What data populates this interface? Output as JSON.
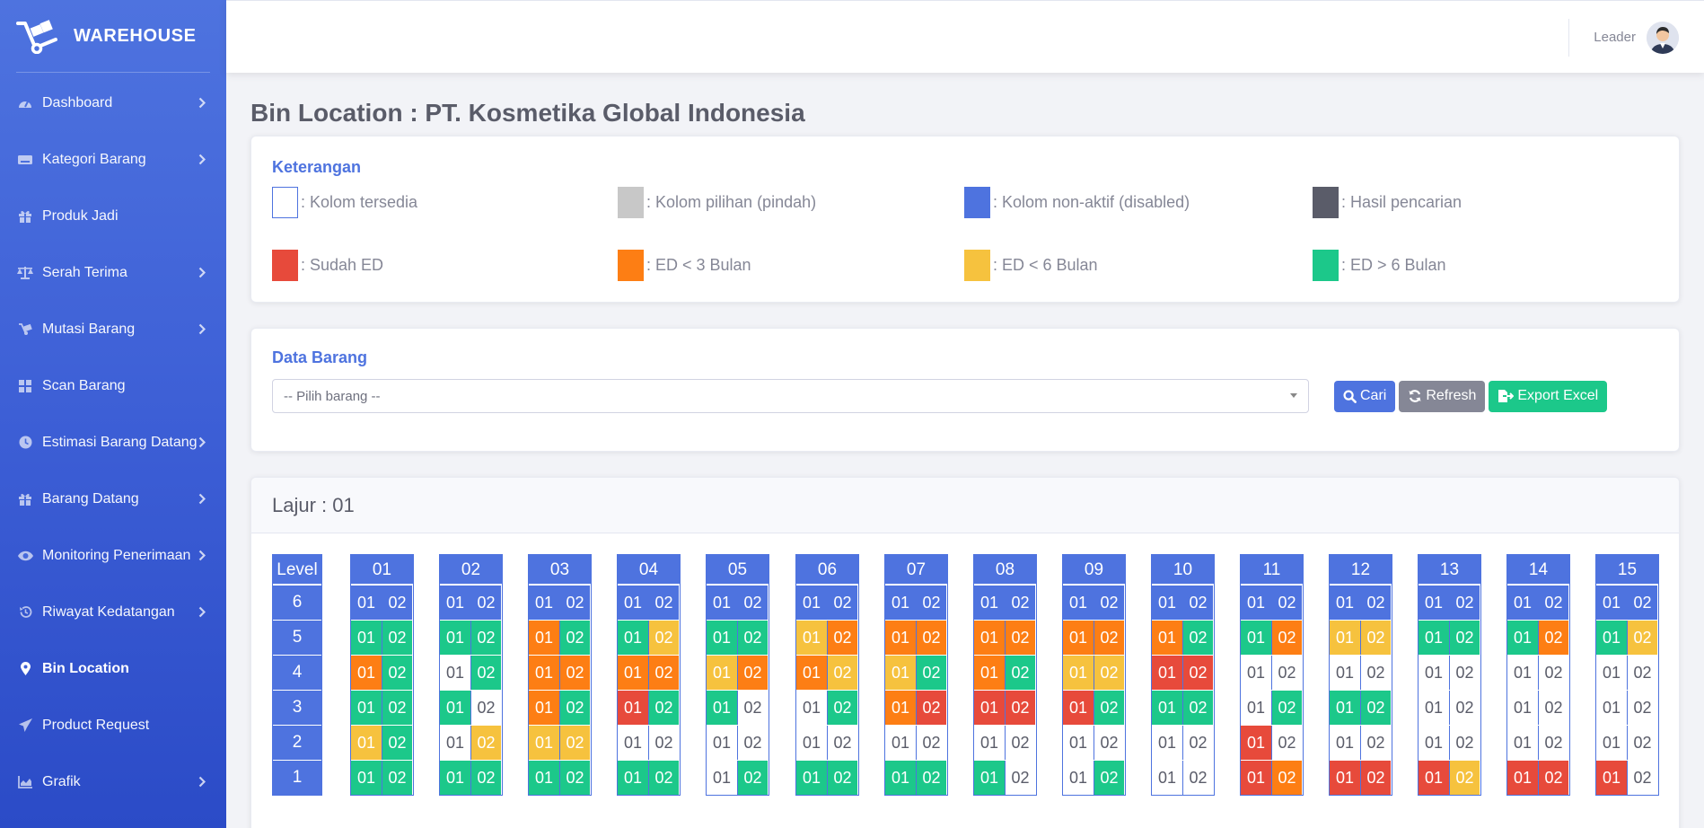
{
  "brand": {
    "name": "WAREHOUSE",
    "icon": "hand-truck-icon"
  },
  "sidebar": {
    "items": [
      {
        "label": "Dashboard",
        "icon": "tachometer-icon",
        "chevron": true,
        "active": false
      },
      {
        "label": "Kategori Barang",
        "icon": "keyboard-icon",
        "chevron": true,
        "active": false
      },
      {
        "label": "Produk Jadi",
        "icon": "gift-icon",
        "chevron": false,
        "active": false
      },
      {
        "label": "Serah Terima",
        "icon": "balance-scale-icon",
        "chevron": true,
        "active": false
      },
      {
        "label": "Mutasi Barang",
        "icon": "dolly-icon",
        "chevron": true,
        "active": false
      },
      {
        "label": "Scan Barang",
        "icon": "th-large-icon",
        "chevron": false,
        "active": false
      },
      {
        "label": "Estimasi Barang Datang",
        "icon": "clock-icon",
        "chevron": true,
        "active": false
      },
      {
        "label": "Barang Datang",
        "icon": "gift-icon",
        "chevron": true,
        "active": false
      },
      {
        "label": "Monitoring Penerimaan",
        "icon": "eye-icon",
        "chevron": true,
        "active": false
      },
      {
        "label": "Riwayat Kedatangan",
        "icon": "history-icon",
        "chevron": true,
        "active": false
      },
      {
        "label": "Bin Location",
        "icon": "map-marker-icon",
        "chevron": false,
        "active": true
      },
      {
        "label": "Product Request",
        "icon": "paper-plane-icon",
        "chevron": false,
        "active": false
      },
      {
        "label": "Grafik",
        "icon": "chart-area-icon",
        "chevron": true,
        "active": false
      }
    ]
  },
  "topbar": {
    "user_name": "Leader"
  },
  "page": {
    "title": "Bin Location : PT. Kosmetika Global Indonesia"
  },
  "legend": {
    "heading": "Keterangan",
    "items": [
      {
        "label": ": Kolom tersedia",
        "swatch": "#ffffff",
        "border": "#4e73df"
      },
      {
        "label": ": Kolom pilihan (pindah)",
        "swatch": "#c8c8c8",
        "border": "#c8c8c8"
      },
      {
        "label": ": Kolom non-aktif (disabled)",
        "swatch": "#4e73df",
        "border": "#4e73df"
      },
      {
        "label": ": Hasil pencarian",
        "swatch": "#5a5c69",
        "border": "#5a5c69"
      },
      {
        "label": ": Sudah ED",
        "swatch": "#e74a3b",
        "border": "#e74a3b"
      },
      {
        "label": ": ED < 3 Bulan",
        "swatch": "#fd7e14",
        "border": "#fd7e14"
      },
      {
        "label": ": ED < 6 Bulan",
        "swatch": "#f6c23e",
        "border": "#f6c23e"
      },
      {
        "label": ": ED > 6 Bulan",
        "swatch": "#1cc88a",
        "border": "#1cc88a"
      }
    ]
  },
  "data_barang": {
    "heading": "Data Barang",
    "select_value": "-- Pilih barang --",
    "btn_cari": "Cari",
    "btn_refresh": "Refresh",
    "btn_export": "Export Excel"
  },
  "lajur": {
    "title": "Lajur : 01",
    "level_header": "Level",
    "levels": [
      "6",
      "5",
      "4",
      "3",
      "2",
      "1"
    ],
    "column_labels": [
      "01",
      "02"
    ],
    "racks": [
      {
        "label": "01",
        "rows": [
          [
            "D",
            "D"
          ],
          [
            "G",
            "G"
          ],
          [
            "O",
            "G"
          ],
          [
            "G",
            "G"
          ],
          [
            "Y",
            "G"
          ],
          [
            "G",
            "G"
          ]
        ]
      },
      {
        "label": "02",
        "rows": [
          [
            "D",
            "D"
          ],
          [
            "G",
            "G"
          ],
          [
            "E",
            "G"
          ],
          [
            "G",
            "E"
          ],
          [
            "E",
            "Y"
          ],
          [
            "G",
            "G"
          ]
        ]
      },
      {
        "label": "03",
        "rows": [
          [
            "D",
            "D"
          ],
          [
            "O",
            "G"
          ],
          [
            "O",
            "O"
          ],
          [
            "O",
            "G"
          ],
          [
            "Y",
            "Y"
          ],
          [
            "G",
            "G"
          ]
        ]
      },
      {
        "label": "04",
        "rows": [
          [
            "D",
            "D"
          ],
          [
            "G",
            "Y"
          ],
          [
            "O",
            "O"
          ],
          [
            "R",
            "G"
          ],
          [
            "E",
            "E"
          ],
          [
            "G",
            "G"
          ]
        ]
      },
      {
        "label": "05",
        "rows": [
          [
            "D",
            "D"
          ],
          [
            "G",
            "G"
          ],
          [
            "Y",
            "O"
          ],
          [
            "G",
            "E"
          ],
          [
            "E",
            "E"
          ],
          [
            "E",
            "G"
          ]
        ]
      },
      {
        "label": "06",
        "rows": [
          [
            "D",
            "D"
          ],
          [
            "Y",
            "O"
          ],
          [
            "O",
            "Y"
          ],
          [
            "E",
            "G"
          ],
          [
            "E",
            "E"
          ],
          [
            "G",
            "G"
          ]
        ]
      },
      {
        "label": "07",
        "rows": [
          [
            "D",
            "D"
          ],
          [
            "O",
            "O"
          ],
          [
            "Y",
            "G"
          ],
          [
            "O",
            "R"
          ],
          [
            "E",
            "E"
          ],
          [
            "G",
            "G"
          ]
        ]
      },
      {
        "label": "08",
        "rows": [
          [
            "D",
            "D"
          ],
          [
            "O",
            "O"
          ],
          [
            "O",
            "G"
          ],
          [
            "R",
            "R"
          ],
          [
            "E",
            "E"
          ],
          [
            "G",
            "E"
          ]
        ]
      },
      {
        "label": "09",
        "rows": [
          [
            "D",
            "D"
          ],
          [
            "O",
            "O"
          ],
          [
            "Y",
            "Y"
          ],
          [
            "R",
            "G"
          ],
          [
            "E",
            "E"
          ],
          [
            "E",
            "G"
          ]
        ]
      },
      {
        "label": "10",
        "rows": [
          [
            "D",
            "D"
          ],
          [
            "O",
            "G"
          ],
          [
            "R",
            "R"
          ],
          [
            "G",
            "G"
          ],
          [
            "E",
            "E"
          ],
          [
            "E",
            "E"
          ]
        ]
      },
      {
        "label": "11",
        "rows": [
          [
            "D",
            "D"
          ],
          [
            "G",
            "O"
          ],
          [
            "E",
            "E"
          ],
          [
            "E",
            "G"
          ],
          [
            "R",
            "E"
          ],
          [
            "R",
            "O"
          ]
        ]
      },
      {
        "label": "12",
        "rows": [
          [
            "D",
            "D"
          ],
          [
            "Y",
            "Y"
          ],
          [
            "E",
            "E"
          ],
          [
            "G",
            "G"
          ],
          [
            "E",
            "E"
          ],
          [
            "R",
            "R"
          ]
        ]
      },
      {
        "label": "13",
        "rows": [
          [
            "D",
            "D"
          ],
          [
            "G",
            "G"
          ],
          [
            "E",
            "E"
          ],
          [
            "E",
            "E"
          ],
          [
            "E",
            "E"
          ],
          [
            "R",
            "Y"
          ]
        ]
      },
      {
        "label": "14",
        "rows": [
          [
            "D",
            "D"
          ],
          [
            "G",
            "O"
          ],
          [
            "E",
            "E"
          ],
          [
            "E",
            "E"
          ],
          [
            "E",
            "E"
          ],
          [
            "R",
            "R"
          ]
        ]
      },
      {
        "label": "15",
        "rows": [
          [
            "D",
            "D"
          ],
          [
            "G",
            "Y"
          ],
          [
            "E",
            "E"
          ],
          [
            "E",
            "E"
          ],
          [
            "E",
            "E"
          ],
          [
            "R",
            "E"
          ]
        ]
      }
    ],
    "status_legend": {
      "D": "disabled",
      "E": "empty",
      "R": "sudah-ed",
      "O": "ed-lt-3",
      "Y": "ed-lt-6",
      "G": "ed-gt-6"
    }
  },
  "colors": {
    "primary": "#4e73df",
    "red": "#e74a3b",
    "orange": "#fd7e14",
    "yellow": "#f6c23e",
    "green": "#1cc88a",
    "gray": "#858796"
  }
}
